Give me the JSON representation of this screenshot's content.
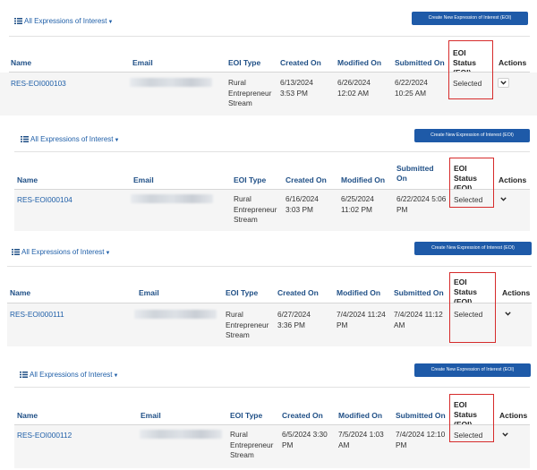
{
  "panels": [
    {
      "filter_label": "All Expressions of Interest",
      "create_label": "Create New Expression of Interest (EOI)",
      "columns": {
        "name": "Name",
        "email": "Email",
        "eoi_type": "EOI Type",
        "created_on": "Created On",
        "modified_on": "Modified On",
        "submitted_on": "Submitted On",
        "status": "EOI Status (EOI)",
        "actions": "Actions"
      },
      "row": {
        "name": "RES-EOI000103",
        "eoi_type": "Rural Entrepreneur Stream",
        "created_on": "6/13/2024 3:53 PM",
        "modified_on": "6/26/2024 12:02 AM",
        "submitted_on": "6/22/2024 10:25 AM",
        "status": "Selected"
      }
    },
    {
      "filter_label": "All Expressions of Interest",
      "create_label": "Create New Expression of Interest (EOI)",
      "columns": {
        "name": "Name",
        "email": "Email",
        "eoi_type": "EOI Type",
        "created_on": "Created On",
        "modified_on": "Modified On",
        "submitted_on": "Submitted On",
        "status": "EOI Status (EOI)",
        "actions": "Actions"
      },
      "row": {
        "name": "RES-EOI000104",
        "eoi_type": "Rural Entrepreneur Stream",
        "created_on": "6/16/2024 3:03 PM",
        "modified_on": "6/25/2024 11:02 PM",
        "submitted_on": "6/22/2024 5:06 PM",
        "status": "Selected"
      }
    },
    {
      "filter_label": "All Expressions of Interest",
      "create_label": "Create New Expression of Interest (EOI)",
      "columns": {
        "name": "Name",
        "email": "Email",
        "eoi_type": "EOI Type",
        "created_on": "Created On",
        "modified_on": "Modified On",
        "submitted_on": "Submitted On",
        "status": "EOI Status (EOI)",
        "actions": "Actions"
      },
      "row": {
        "name": "RES-EOI000111",
        "eoi_type": "Rural Entrepreneur Stream",
        "created_on": "6/27/2024 3:36 PM",
        "modified_on": "7/4/2024 11:24 PM",
        "submitted_on": "7/4/2024 11:12 AM",
        "status": "Selected"
      }
    },
    {
      "filter_label": "All Expressions of Interest",
      "create_label": "Create New Expression of Interest (EOI)",
      "columns": {
        "name": "Name",
        "email": "Email",
        "eoi_type": "EOI Type",
        "created_on": "Created On",
        "modified_on": "Modified On",
        "submitted_on": "Submitted On",
        "status": "EOI Status (EOI)",
        "actions": "Actions"
      },
      "row": {
        "name": "RES-EOI000112",
        "eoi_type": "Rural Entrepreneur Stream",
        "created_on": "6/5/2024 3:30 PM",
        "modified_on": "7/5/2024 1:03 AM",
        "submitted_on": "7/4/2024 12:10 PM",
        "status": "Selected"
      }
    }
  ],
  "icons": {
    "filter": "list-icon",
    "filter_caret": "caret-down-icon",
    "action": "chevron-down-icon"
  },
  "colors": {
    "link": "#1f5fa8",
    "header": "#1f4f86",
    "button": "#1e5aa8",
    "highlight": "#d62b2b"
  }
}
